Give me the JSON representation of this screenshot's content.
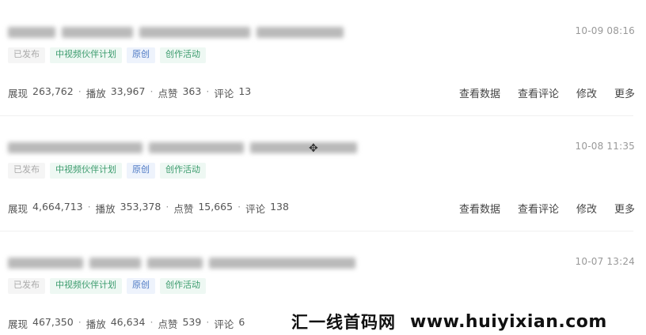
{
  "posts": [
    {
      "time": "10-09 08:16",
      "tags": [
        "已发布",
        "中视频伙伴计划",
        "原创",
        "创作活动"
      ],
      "stats": {
        "impressions_label": "展现",
        "impressions": "263,762",
        "plays_label": "播放",
        "plays": "33,967",
        "likes_label": "点赞",
        "likes": "363",
        "comments_label": "评论",
        "comments": "13"
      }
    },
    {
      "time": "10-08 11:35",
      "tags": [
        "已发布",
        "中视频伙伴计划",
        "原创",
        "创作活动"
      ],
      "stats": {
        "impressions_label": "展现",
        "impressions": "4,664,713",
        "plays_label": "播放",
        "plays": "353,378",
        "likes_label": "点赞",
        "likes": "15,665",
        "comments_label": "评论",
        "comments": "138"
      }
    },
    {
      "time": "10-07 13:24",
      "tags": [
        "已发布",
        "中视频伙伴计划",
        "原创",
        "创作活动"
      ],
      "stats": {
        "impressions_label": "展现",
        "impressions": "467,350",
        "plays_label": "播放",
        "plays": "46,634",
        "likes_label": "点赞",
        "likes": "539",
        "comments_label": "评论",
        "comments": "6"
      }
    }
  ],
  "actions": {
    "view_data": "查看数据",
    "view_comments": "查看评论",
    "edit": "修改",
    "more": "更多"
  },
  "watermark": {
    "name": "汇一线首码网",
    "url": "www.huiyixian.com"
  },
  "icons": {
    "cursor": "move-cursor-icon"
  }
}
